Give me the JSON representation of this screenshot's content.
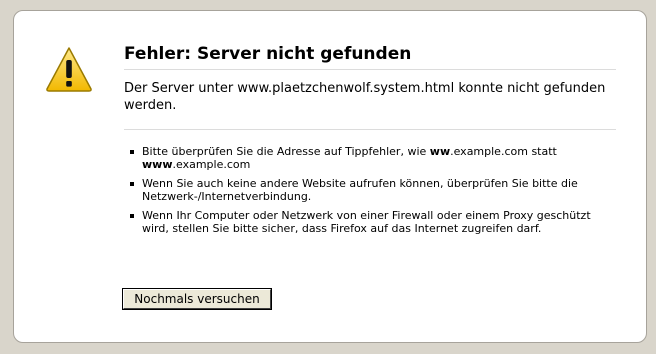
{
  "error_page": {
    "title": "Fehler: Server nicht gefunden",
    "description": "Der Server unter www.plaetzchenwolf.system.html konnte nicht gefunden werden.",
    "icon": "warning-icon",
    "hints": [
      {
        "parts": [
          {
            "text": "Bitte überprüfen Sie die Adresse auf Tippfehler, wie ",
            "bold": false
          },
          {
            "text": "ww",
            "bold": true
          },
          {
            "text": ".example.com statt ",
            "bold": false
          },
          {
            "text": "www",
            "bold": true
          },
          {
            "text": ".example.com",
            "bold": false
          }
        ]
      },
      {
        "parts": [
          {
            "text": "Wenn Sie auch keine andere Website aufrufen können, überprüfen Sie bitte die Netzwerk-/Internetverbindung.",
            "bold": false
          }
        ]
      },
      {
        "parts": [
          {
            "text": "Wenn Ihr Computer oder Netzwerk von einer Firewall oder einem Proxy geschützt wird, stellen Sie bitte sicher, dass Firefox auf das Internet zugreifen darf.",
            "bold": false
          }
        ]
      }
    ],
    "retry_label": "Nochmals versuchen"
  },
  "colors": {
    "background": "#d9d5cb",
    "box": "#ffffff",
    "warning_yellow": "#f5c400"
  }
}
